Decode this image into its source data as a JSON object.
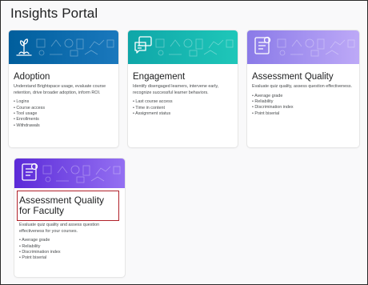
{
  "page": {
    "title": "Insights Portal"
  },
  "cards": [
    {
      "title": "Adoption",
      "description": "Understand Brightspace usage, evaluate course retention, drive broader adoption, inform ROI.",
      "items": [
        "Logins",
        "Course access",
        "Tool usage",
        "Enrollments",
        "Withdrawals"
      ],
      "banner_color_start": "#005e9c",
      "banner_color_end": "#0a75b8",
      "icon": "plant-icon"
    },
    {
      "title": "Engagement",
      "description": "Identify disengaged learners, intervene early, recognize successful learner behaviors.",
      "items": [
        "Last course access",
        "Time in content",
        "Assignment status"
      ],
      "banner_color_start": "#0fa6a8",
      "banner_color_end": "#17c0b4",
      "icon": "chat-bubbles-icon"
    },
    {
      "title": "Assessment Quality",
      "description": "Evaluate quiz quality, assess question effectiveness.",
      "items": [
        "Average grade",
        "Reliability",
        "Discrimination index",
        "Point biserial"
      ],
      "banner_color_start": "#8a7ae8",
      "banner_color_end": "#b9a7f6",
      "icon": "quiz-document-icon"
    },
    {
      "title": "Assessment Quality for Faculty",
      "description": "Evaluate quiz quality and assess question effectiveness for your courses.",
      "items": [
        "Average grade",
        "Reliability",
        "Discrimination index",
        "Point biserial"
      ],
      "banner_color_start": "#5b2ad8",
      "banner_color_end": "#8a64f0",
      "icon": "quiz-document-icon"
    }
  ],
  "highlight_color": "#b0212a"
}
